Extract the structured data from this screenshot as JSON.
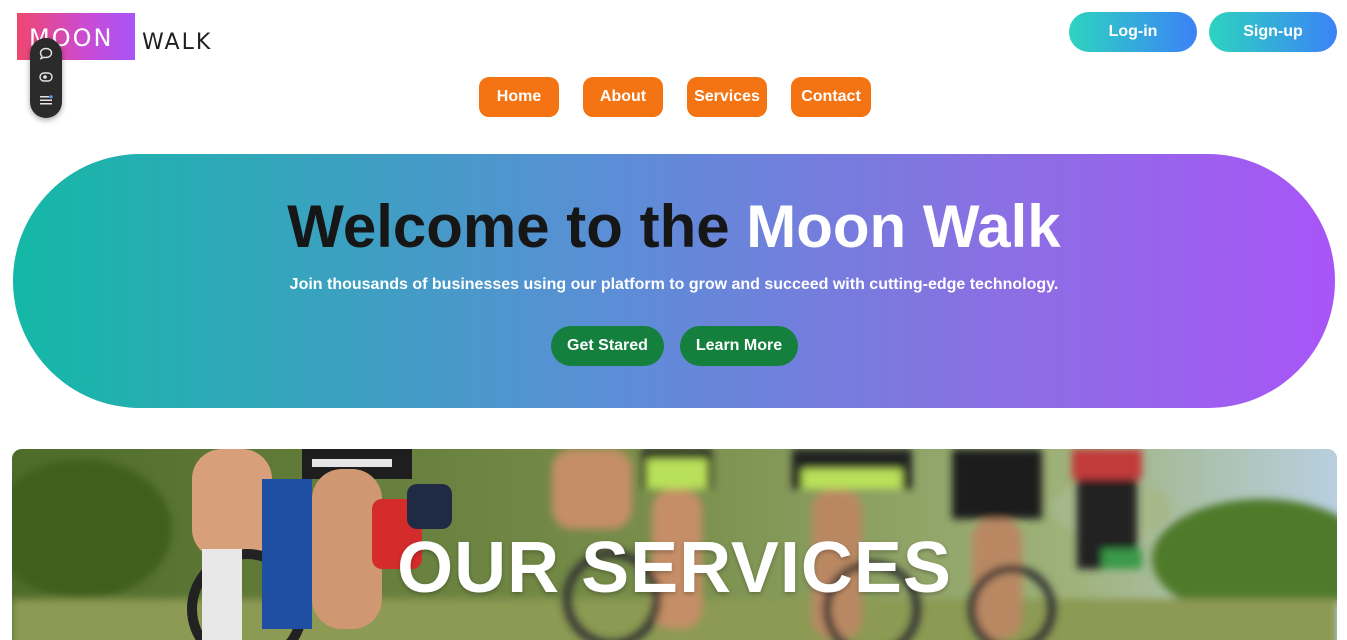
{
  "logo": {
    "word1": "MOON",
    "word2": "WALK"
  },
  "floating_toolbar": {
    "icons": [
      "chat-bubble-icon",
      "eye-icon",
      "list-icon"
    ]
  },
  "auth": {
    "login_label": "Log-in",
    "signup_label": "Sign-up"
  },
  "nav": {
    "items": [
      {
        "label": "Home"
      },
      {
        "label": "About"
      },
      {
        "label": "Services"
      },
      {
        "label": "Contact"
      }
    ]
  },
  "hero": {
    "title_main": "Welcome to the ",
    "title_accent": "Moon Walk",
    "subtitle": "Join thousands of businesses using our platform to grow and succeed with cutting-edge technology.",
    "primary_cta": "Get Stared",
    "secondary_cta": "Learn More"
  },
  "services": {
    "title": "OUR SERVICES"
  },
  "colors": {
    "nav_orange": "#f47414",
    "cta_green": "#15803d",
    "hero_gradient_start": "#14b8a6",
    "hero_gradient_end": "#a855f7",
    "auth_gradient_start": "#2dd4bf",
    "auth_gradient_end": "#3b82f6"
  }
}
